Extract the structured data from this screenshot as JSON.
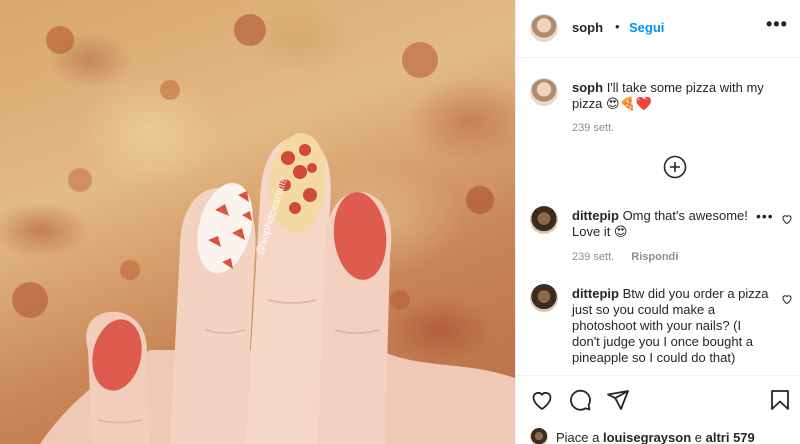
{
  "header": {
    "username": "soph",
    "separator": "•",
    "follow_label": "Segui",
    "more_label": "•••"
  },
  "caption": {
    "username": "soph",
    "text": "I'll take some pizza with my pizza 😍🍕❤️",
    "time": "239 sett."
  },
  "load_more_icon": "plus-circle-icon",
  "comments": [
    {
      "username": "dittepip",
      "text": "Omg that's awesome! Love it 😍",
      "time": "239 sett.",
      "reply_label": "Rispondi",
      "more_label": "•••"
    },
    {
      "username": "dittepip",
      "text": "Btw did you order a pizza just so you could make a photoshoot with your nails? (I don't judge you I once bought a pineapple so I could do that)"
    }
  ],
  "photo": {
    "watermark": "@sophdoesnails"
  },
  "actions": {
    "icons": [
      "heart-icon",
      "comment-icon",
      "share-icon",
      "bookmark-icon"
    ],
    "likes_prefix": "Piace a",
    "likes_user": "louisegrayson",
    "likes_conj": "e",
    "likes_others": "altri 579"
  },
  "colors": {
    "link_blue": "#0095f6",
    "muted_text": "#8e8e8e",
    "border": "#efefef"
  }
}
